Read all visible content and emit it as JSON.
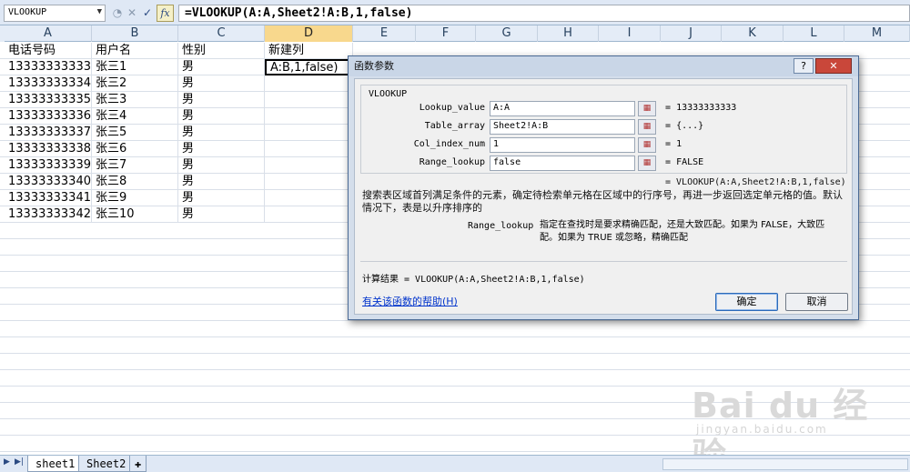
{
  "formula_bar": {
    "name_box": "VLOOKUP",
    "formula": "=VLOOKUP(A:A,Sheet2!A:B,1,false)",
    "cancel_glyph": "✕",
    "enter_glyph": "✓",
    "fx_glyph": "fx"
  },
  "columns": [
    "A",
    "B",
    "C",
    "D",
    "E",
    "F",
    "G",
    "H",
    "I",
    "J",
    "K",
    "L",
    "M"
  ],
  "rows": [
    [
      "电话号码",
      "用户名",
      "性别",
      "新建列"
    ],
    [
      "13333333333",
      "张三1",
      "男",
      "A:B,1,false)"
    ],
    [
      "13333333334",
      "张三2",
      "男",
      ""
    ],
    [
      "13333333335",
      "张三3",
      "男",
      ""
    ],
    [
      "13333333336",
      "张三4",
      "男",
      ""
    ],
    [
      "13333333337",
      "张三5",
      "男",
      ""
    ],
    [
      "13333333338",
      "张三6",
      "男",
      ""
    ],
    [
      "13333333339",
      "张三7",
      "男",
      ""
    ],
    [
      "13333333340",
      "张三8",
      "男",
      ""
    ],
    [
      "13333333341",
      "张三9",
      "男",
      ""
    ],
    [
      "13333333342",
      "张三10",
      "男",
      ""
    ]
  ],
  "sheets": [
    "sheet1",
    "Sheet2"
  ],
  "dialog": {
    "title": "函数参数",
    "help_glyph": "?",
    "close_glyph": "✕",
    "function_name": "VLOOKUP",
    "args": [
      {
        "label": "Lookup_value",
        "value": "A:A",
        "result": "13333333333"
      },
      {
        "label": "Table_array",
        "value": "Sheet2!A:B",
        "result": "{...}"
      },
      {
        "label": "Col_index_num",
        "value": "1",
        "result": "1"
      },
      {
        "label": "Range_lookup",
        "value": "false",
        "result": "FALSE"
      }
    ],
    "equals": "=",
    "formula_result": "= VLOOKUP(A:A,Sheet2!A:B,1,false)",
    "description": "搜索表区域首列满足条件的元素，确定待检索单元格在区域中的行序号，再进一步返回选定单元格的值。默认情况下，表是以升序排序的",
    "arg_desc_label": "Range_lookup",
    "arg_desc": "指定在查找时是要求精确匹配，还是大致匹配。如果为 FALSE，大致匹配。如果为 TRUE 或忽略，精确匹配",
    "calc_result": "计算结果 = VLOOKUP(A:A,Sheet2!A:B,1,false)",
    "help_link": "有关该函数的帮助(H)",
    "ok": "确定",
    "cancel": "取消"
  },
  "watermark": {
    "main": "Bai du 经验",
    "sub": "jingyan.baidu.com"
  },
  "colors": {
    "header_bg": "#e4ecf7",
    "active_col": "#f8d88d",
    "dialog_bg": "#d4deeb",
    "close_btn": "#c9473a"
  }
}
